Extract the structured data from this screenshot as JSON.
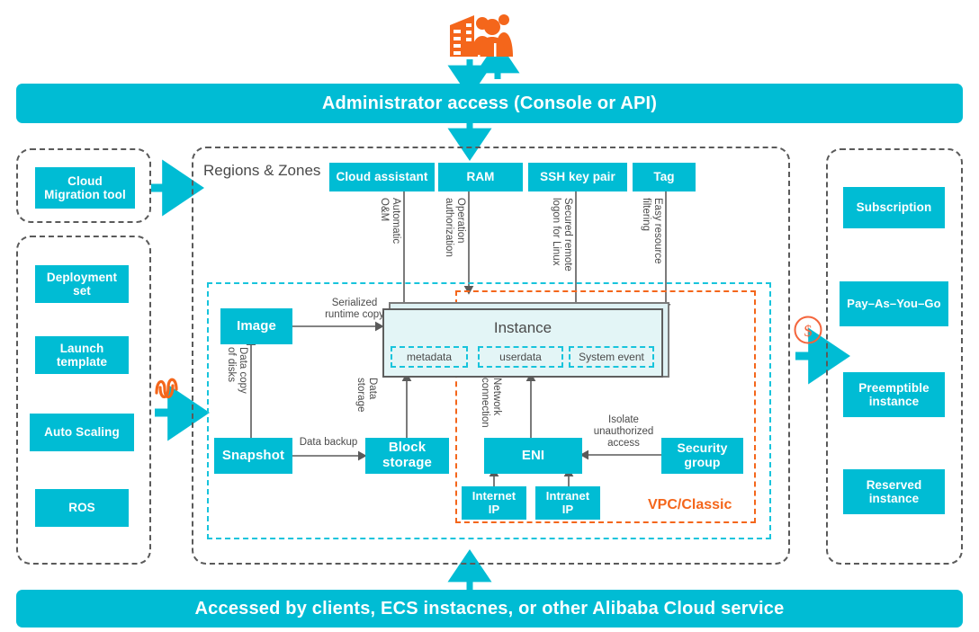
{
  "top": {
    "actor_icon": "building-people-icon",
    "banner": "Administrator access (Console or API)"
  },
  "bottom": {
    "banner": "Accessed by clients, ECS instacnes, or other Alibaba Cloud service"
  },
  "left": {
    "migration_group": {
      "items": [
        {
          "label": "Cloud\nMigration tool"
        }
      ]
    },
    "deploy_group": {
      "items": [
        {
          "label": "Deployment\nset"
        },
        {
          "label": "Launch\ntemplate"
        },
        {
          "label": "Auto Scaling"
        },
        {
          "label": "ROS"
        }
      ]
    },
    "squiggle_icon": "elasticity-wave-icon"
  },
  "right": {
    "billing_group": {
      "items": [
        {
          "label": "Subscription"
        },
        {
          "label": "Pay–As–You–Go"
        },
        {
          "label": "Preemptible\ninstance"
        },
        {
          "label": "Reserved\ninstance"
        }
      ]
    },
    "price_icon": "dollar-circle-icon"
  },
  "regions": {
    "title": "Regions & Zones",
    "top_services": [
      {
        "label": "Cloud assistant",
        "edge": "Automatic\nO&M"
      },
      {
        "label": "RAM",
        "edge": "Operation\nauthorization"
      },
      {
        "label": "SSH key pair",
        "edge": "Secured remote\nlogon for Linux"
      },
      {
        "label": "Tag",
        "edge": "Easy resource\nfiltering"
      }
    ],
    "instance": {
      "title": "Instance",
      "components": [
        {
          "label": "metadata"
        },
        {
          "label": "userdata"
        },
        {
          "label": "System event"
        }
      ]
    },
    "nodes": [
      {
        "label": "Image"
      },
      {
        "label": "Snapshot"
      },
      {
        "label": "Block\nstorage"
      },
      {
        "label": "ENI"
      },
      {
        "label": "Security\ngroup"
      },
      {
        "label": "Internet\nIP"
      },
      {
        "label": "Intranet\nIP"
      }
    ],
    "edges": [
      {
        "label": "Serialized\nruntime copy"
      },
      {
        "label": "Data copy\nof disks"
      },
      {
        "label": "Data backup"
      },
      {
        "label": "Data\nstorage"
      },
      {
        "label": "Network\nconnection"
      },
      {
        "label": "Isolate\nunauthorized\naccess"
      }
    ],
    "vpc_label": "VPC/Classic"
  },
  "colors": {
    "cyan": "#00BCD4",
    "cyan_dash": "#18C4DC",
    "orange": "#F4661B",
    "gray_dash": "#5a5a5a",
    "instance_fill": "#E3F5F6"
  }
}
